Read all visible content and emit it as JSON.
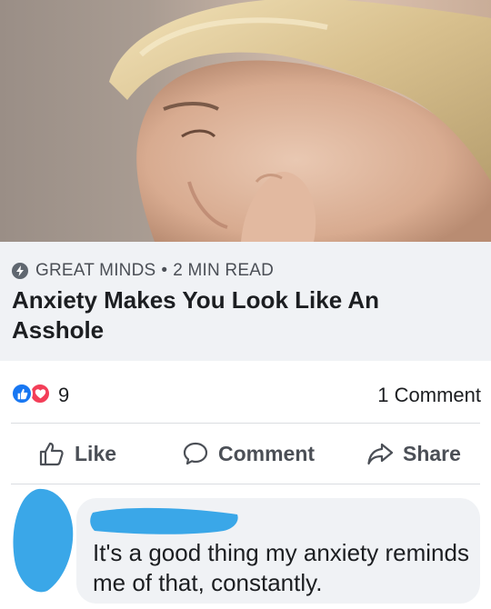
{
  "post": {
    "image_alt": "woman-face-closeup-photo",
    "source_name": "GREAT MINDS",
    "separator": "•",
    "read_time": "2 MIN READ",
    "headline": "Anxiety Makes You Look Like An Asshole"
  },
  "reactions": {
    "icons": [
      "like-reaction-icon",
      "love-reaction-icon"
    ],
    "count": "9",
    "comment_count": "1 Comment"
  },
  "actions": {
    "like": "Like",
    "comment": "Comment",
    "share": "Share"
  },
  "comment": {
    "text": "It's a good thing my anxiety reminds me of that, constantly."
  },
  "colors": {
    "like_blue": "#1877f2",
    "love_red": "#f33e58",
    "redaction_blue": "#3aa7e8",
    "card_bg": "#f0f2f5"
  }
}
